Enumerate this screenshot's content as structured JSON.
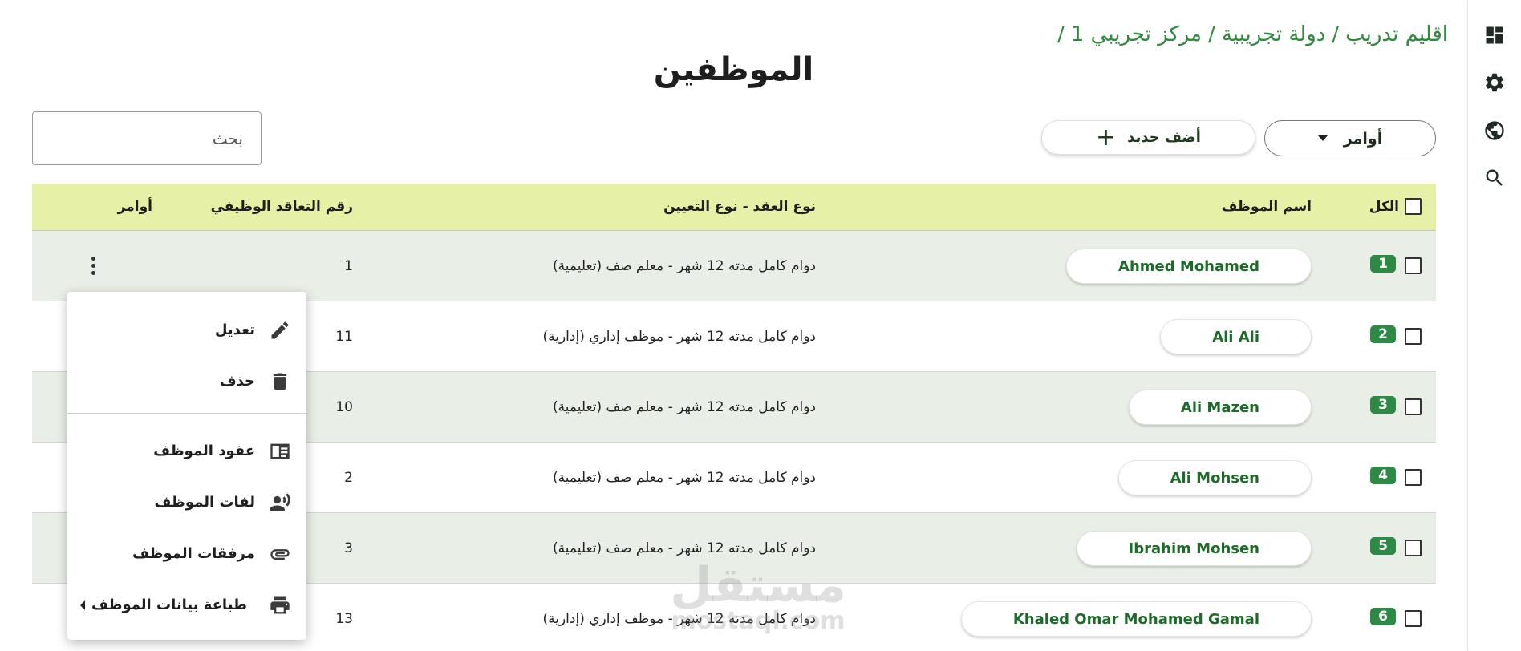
{
  "rail": {
    "items": [
      {
        "name": "dashboard-icon"
      },
      {
        "name": "gear-icon"
      },
      {
        "name": "globe-icon"
      },
      {
        "name": "search-icon"
      }
    ]
  },
  "breadcrumb": {
    "items": [
      "اقليم تدريب",
      "دولة تجريبية",
      "مركز تجريبي 1"
    ],
    "separator": "/"
  },
  "page_title": "الموظفين",
  "toolbar": {
    "commands_label": "أوامر",
    "add_label": "أضف جديد",
    "search_placeholder": "بحث"
  },
  "table": {
    "headers": {
      "select_all": "الكل",
      "name": "اسم الموظف",
      "contract": "نوع العقد - نوع التعيين",
      "number": "رقم التعاقد الوظيفي",
      "actions": "أوامر"
    },
    "rows": [
      {
        "index": "1",
        "name": "Ahmed Mohamed",
        "contract": "دوام كامل مدته 12 شهر - معلم صف (تعليمية)",
        "number": "1"
      },
      {
        "index": "2",
        "name": "Ali Ali",
        "contract": "دوام كامل مدته 12 شهر - موظف إداري (إدارية)",
        "number": "11"
      },
      {
        "index": "3",
        "name": "Ali Mazen",
        "contract": "دوام كامل مدته 12 شهر - معلم صف (تعليمية)",
        "number": "10"
      },
      {
        "index": "4",
        "name": "Ali Mohsen",
        "contract": "دوام كامل مدته 12 شهر - معلم صف (تعليمية)",
        "number": "2"
      },
      {
        "index": "5",
        "name": "Ibrahim Mohsen",
        "contract": "دوام كامل مدته 12 شهر - معلم صف (تعليمية)",
        "number": "3"
      },
      {
        "index": "6",
        "name": "Khaled Omar Mohamed Gamal",
        "contract": "دوام كامل مدته 12 شهر - موظف إداري (إدارية)",
        "number": "13"
      }
    ]
  },
  "row_menu": {
    "edit": "تعديل",
    "delete": "حذف",
    "contracts": "عقود الموظف",
    "files": "لفات الموظف",
    "attachments": "مرفقات الموظف",
    "print": "طباعة بيانات الموظف"
  },
  "watermark": {
    "main": "مستقل",
    "sub": "mostaql.com"
  },
  "colors": {
    "accent": "#2e8b3e",
    "header_bg": "#e6f1a7",
    "badge": "#2c8a46",
    "name_text": "#1d6b28",
    "row_alt": "#e9efe6"
  }
}
